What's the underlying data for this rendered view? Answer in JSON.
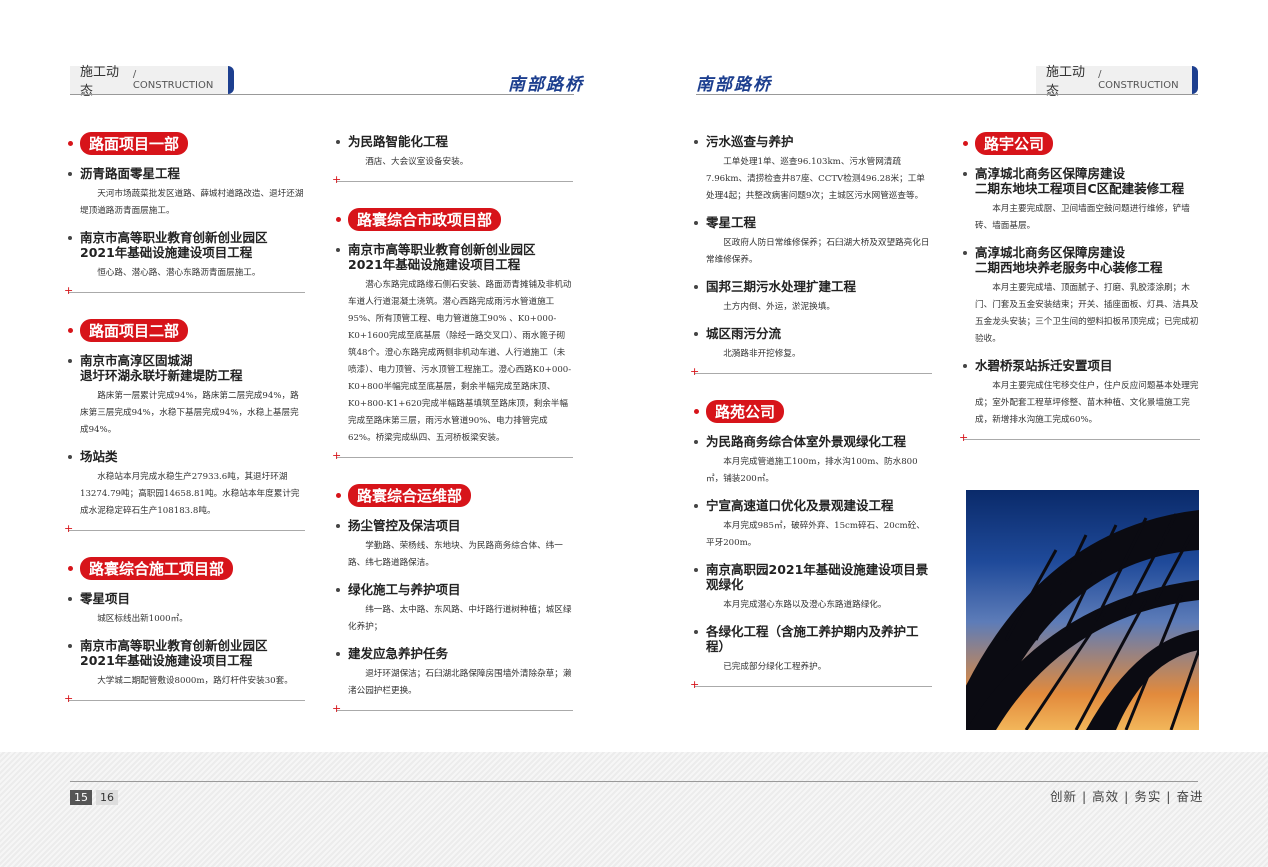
{
  "header": {
    "tab_zh": "施工动态",
    "tab_en": "/ CONSTRUCTION",
    "logo": "南部路桥"
  },
  "col1": [
    {
      "dept": "路面项目一部",
      "items": [
        {
          "title": "沥青路面零星工程",
          "text": "天河市场蔬菜批发区道路、薛城村道路改造、退圩还湖堤顶道路沥青面层施工。"
        },
        {
          "title": "南京市高等职业教育创新创业园区\n2021年基础设施建设项目工程",
          "text": "恒心路、潜心路、潜心东路沥青面层施工。"
        }
      ]
    },
    {
      "dept": "路面项目二部",
      "items": [
        {
          "title": "南京市高淳区固城湖\n退圩环湖永联圩新建堤防工程",
          "text": "路床第一层累计完成94%，路床第二层完成94%，路床第三层完成94%，水稳下基层完成94%，水稳上基层完成94%。"
        },
        {
          "title": "场站类",
          "text": "水稳站本月完成水稳生产27933.6吨，其退圩环湖13274.79吨；高职园14658.81吨。水稳站本年度累计完成水泥稳定碎石生产108183.8吨。"
        }
      ]
    },
    {
      "dept": "路寰综合施工项目部",
      "items": [
        {
          "title": "零星项目",
          "text": "城区标线出新1000㎡。"
        },
        {
          "title": "南京市高等职业教育创新创业园区\n2021年基础设施建设项目工程",
          "text": "大学城二期配管敷设8000m，路灯杆件安装30套。"
        }
      ]
    }
  ],
  "col2": [
    {
      "dept": "",
      "items": [
        {
          "title": "为民路智能化工程",
          "text": "酒店、大会议室设备安装。"
        }
      ]
    },
    {
      "dept": "路寰综合市政项目部",
      "items": [
        {
          "title": "南京市高等职业教育创新创业园区\n2021年基础设施建设项目工程",
          "text": "潜心东路完成路缘石侧石安装、路面沥青摊铺及非机动车道人行道混凝土浇筑。潜心西路完成雨污水管道施工95%、所有顶管工程、电力管道施工90% 、K0+000-K0+1600完成至底基层（除经一路交叉口）、雨水篦子砌筑48个。澄心东路完成两侧非机动车道、人行道施工（未喷漆）、电力顶管、污水顶管工程施工。澄心西路K0+000-K0+800半幅完成至底基层，剩余半幅完成至路床顶、K0+800-K1+620完成半幅路基填筑至路床顶，剩余半幅完成至路床第三层，雨污水管道90%、电力排管完成62%。桥梁完成纵四、五河桥板梁安装。"
        }
      ]
    },
    {
      "dept": "路寰综合运维部",
      "items": [
        {
          "title": "扬尘管控及保洁项目",
          "text": "学勤路、荣杨线、东地块、为民路商务综合体、纬一路、纬七路道路保洁。"
        },
        {
          "title": "绿化施工与养护项目",
          "text": "纬一路、太中路、东风路、中圩路行道树种植；城区绿化养护；"
        },
        {
          "title": "建发应急养护任务",
          "text": "退圩环湖保洁；石臼湖北路保障房围墙外清除杂草；濑渚公园护栏更换。"
        }
      ]
    }
  ],
  "col3": [
    {
      "dept": "",
      "items": [
        {
          "title": "污水巡查与养护",
          "text": "工单处理1单、巡查96.103km、污水管网清疏7.96km、清捞检查井87座、CCTV检测496.28米；工单处理4起；共整改病害问题9次；主城区污水网管巡查等。"
        },
        {
          "title": "零星工程",
          "text": "区政府人防日常维修保养；石臼湖大桥及双望路亮化日常维修保养。"
        },
        {
          "title": "国邦三期污水处理扩建工程",
          "text": "土方内倒、外运，淤泥换填。"
        },
        {
          "title": "城区雨污分流",
          "text": "北漪路非开挖修复。"
        }
      ]
    },
    {
      "dept": "路苑公司",
      "items": [
        {
          "title": "为民路商务综合体室外景观绿化工程",
          "text": "本月完成管道施工100m，排水沟100m、防水800㎡，铺装200㎡。"
        },
        {
          "title": "宁宣高速道口优化及景观建设工程",
          "text": "本月完成985㎡，破碎外弃、15cm碎石、20cm砼、平牙200m。"
        },
        {
          "title": "南京高职园2021年基础设施建设项目景观绿化",
          "text": "本月完成潜心东路以及澄心东路道路绿化。"
        },
        {
          "title": "各绿化工程（含施工养护期内及养护工程）",
          "text": "已完成部分绿化工程养护。"
        }
      ]
    }
  ],
  "col4": [
    {
      "dept": "路宇公司",
      "items": [
        {
          "title": "高淳城北商务区保障房建设\n二期东地块工程项目C区配建装修工程",
          "text": "本月主要完成厨、卫间墙面空鼓问题进行维修，铲墙砖、墙面基层。"
        },
        {
          "title": "高淳城北商务区保障房建设\n二期西地块养老服务中心装修工程",
          "text": "本月主要完成墙、顶面腻子、打磨、乳胶漆涂刷；木门、门套及五金安装结束；开关、插座面板、灯具、洁具及五金龙头安装；三个卫生间的塑料扣板吊顶完成；已完成初验收。"
        },
        {
          "title": "水碧桥泵站拆迁安置项目",
          "text": "本月主要完成住宅移交住户，住户反应问题基本处理完成；室外配套工程草坪修整、苗木种植、文化景墙施工完成，新增排水沟施工完成60%。"
        }
      ]
    }
  ],
  "footer": {
    "page_left": "15",
    "page_right": "16",
    "motto": "创新 | 高效 | 务实 | 奋进"
  }
}
